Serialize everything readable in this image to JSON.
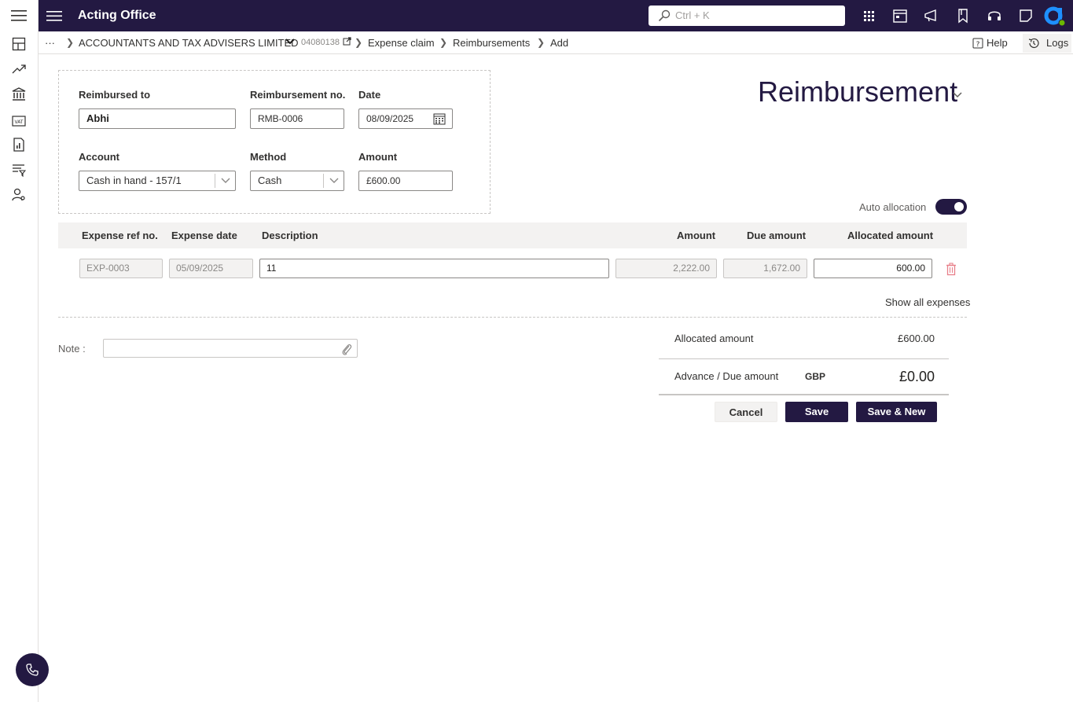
{
  "app": {
    "title": "Acting Office"
  },
  "search": {
    "placeholder": "Ctrl + K"
  },
  "breadcrumb": {
    "ellipsis": "···",
    "company": "ACCOUNTANTS AND TAX ADVISERS LIMITED",
    "company_no": "04080138",
    "items": [
      "Expense claim",
      "Reimbursements",
      "Add"
    ]
  },
  "header_actions": {
    "help": "Help",
    "logs": "Logs"
  },
  "form": {
    "reimbursed_to_label": "Reimbursed to",
    "reimbursed_to_value": "Abhi",
    "reimb_no_label": "Reimbursement no.",
    "reimb_no_value": "RMB-0006",
    "date_label": "Date",
    "date_value": "08/09/2025",
    "account_label": "Account",
    "account_value": "Cash in hand - 157/1",
    "method_label": "Method",
    "method_value": "Cash",
    "amount_label": "Amount",
    "amount_value": "£600.00"
  },
  "doc_title": "Reimbursement",
  "auto_allocation": {
    "label": "Auto allocation",
    "on": true
  },
  "table": {
    "headers": [
      "Expense ref no.",
      "Expense date",
      "Description",
      "Amount",
      "Due amount",
      "Allocated amount"
    ],
    "rows": [
      {
        "ref": "EXP-0003",
        "date": "05/09/2025",
        "description": "11",
        "amount": "2,222.00",
        "due": "1,672.00",
        "allocated": "600.00"
      }
    ]
  },
  "show_all": "Show all expenses",
  "note": {
    "label": "Note :"
  },
  "summary": {
    "allocated_label": "Allocated amount",
    "allocated_value": "£600.00",
    "advance_label": "Advance / Due amount",
    "currency": "GBP",
    "advance_value": "£0.00"
  },
  "buttons": {
    "cancel": "Cancel",
    "save": "Save",
    "save_new": "Save & New"
  },
  "colors": {
    "brand": "#231942",
    "danger": "#e8808a"
  }
}
